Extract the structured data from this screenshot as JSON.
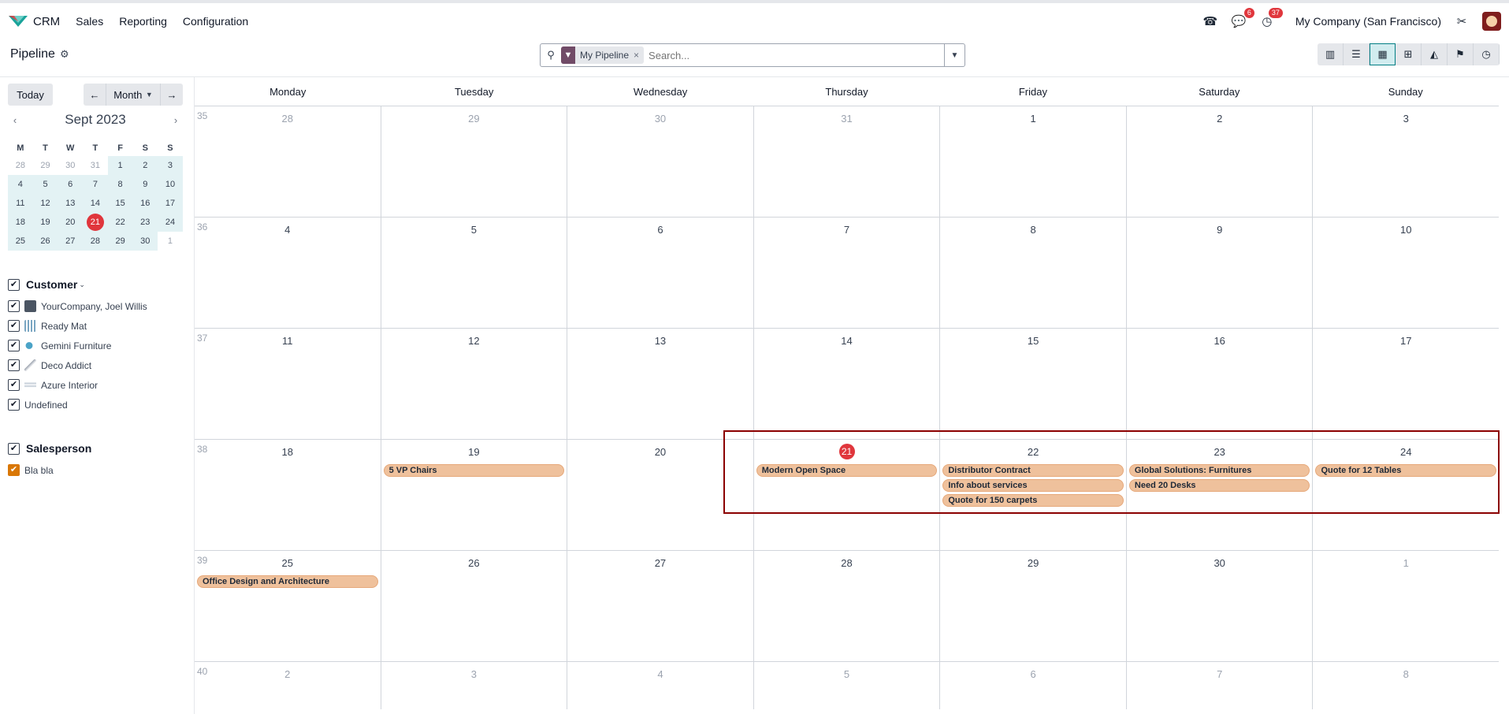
{
  "topnav": {
    "app_name": "CRM",
    "menu": [
      "Sales",
      "Reporting",
      "Configuration"
    ],
    "messages_count": "6",
    "activities_count": "37",
    "company": "My Company (San Francisco)"
  },
  "control": {
    "title": "Pipeline",
    "facet_label": "My Pipeline",
    "facet_close": "×",
    "search_placeholder": "Search...",
    "views": [
      "kanban-icon",
      "list-icon",
      "calendar-icon",
      "pivot-icon",
      "graph-icon",
      "map-icon",
      "activity-icon"
    ],
    "active_view": "calendar-icon"
  },
  "sidebar": {
    "today_label": "Today",
    "range_label": "Month",
    "mini_title": "Sept 2023",
    "mini_dow": [
      "M",
      "T",
      "W",
      "T",
      "F",
      "S",
      "S"
    ],
    "mini_days": [
      [
        "28",
        "29",
        "30",
        "31",
        "1",
        "2",
        "3"
      ],
      [
        "4",
        "5",
        "6",
        "7",
        "8",
        "9",
        "10"
      ],
      [
        "11",
        "12",
        "13",
        "14",
        "15",
        "16",
        "17"
      ],
      [
        "18",
        "19",
        "20",
        "21",
        "22",
        "23",
        "24"
      ],
      [
        "25",
        "26",
        "27",
        "28",
        "29",
        "30",
        "1"
      ]
    ],
    "customer_label": "Customer",
    "customers": [
      "YourCompany, Joel Willis",
      "Ready Mat",
      "Gemini Furniture",
      "Deco Addict",
      "Azure Interior",
      "Undefined"
    ],
    "salesperson_label": "Salesperson",
    "salespersons": [
      "Bla bla"
    ]
  },
  "calendar": {
    "dow": [
      "Monday",
      "Tuesday",
      "Wednesday",
      "Thursday",
      "Friday",
      "Saturday",
      "Sunday"
    ],
    "weeks": [
      {
        "num": "35",
        "days": [
          "28",
          "29",
          "30",
          "31",
          "1",
          "2",
          "3"
        ]
      },
      {
        "num": "36",
        "days": [
          "4",
          "5",
          "6",
          "7",
          "8",
          "9",
          "10"
        ]
      },
      {
        "num": "37",
        "days": [
          "11",
          "12",
          "13",
          "14",
          "15",
          "16",
          "17"
        ]
      },
      {
        "num": "38",
        "days": [
          "18",
          "19",
          "20",
          "21",
          "22",
          "23",
          "24"
        ]
      },
      {
        "num": "39",
        "days": [
          "25",
          "26",
          "27",
          "28",
          "29",
          "30",
          "1"
        ]
      },
      {
        "num": "40",
        "days": [
          "2",
          "3",
          "4",
          "5",
          "6",
          "7",
          "8"
        ]
      }
    ],
    "events": {
      "w3d1": [
        "5 VP Chairs"
      ],
      "w3d3": [
        "Modern Open Space"
      ],
      "w3d4": [
        "Distributor Contract",
        "Info about services",
        "Quote for 150 carpets"
      ],
      "w3d5": [
        "Global Solutions: Furnitures",
        "Need 20 Desks"
      ],
      "w3d6": [
        "Quote for 12 Tables"
      ],
      "w4d0": [
        "Office Design and Architecture"
      ]
    },
    "event_color": "#efc19c",
    "today_color": "#e0363c"
  }
}
